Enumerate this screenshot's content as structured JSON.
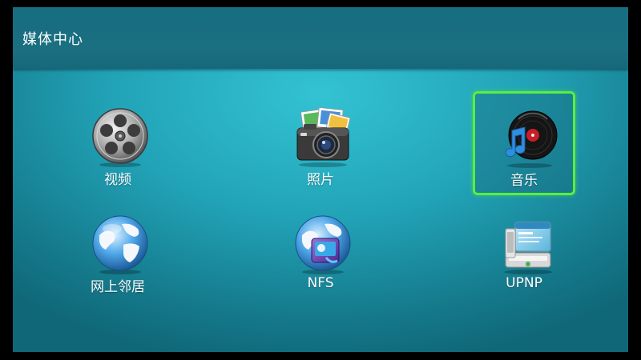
{
  "header": {
    "title": "媒体中心"
  },
  "tiles": [
    {
      "label": "视频",
      "icon": "film-reel-icon"
    },
    {
      "label": "照片",
      "icon": "camera-photos-icon"
    },
    {
      "label": "音乐",
      "icon": "music-vinyl-icon",
      "focused": true
    },
    {
      "label": "网上邻居",
      "icon": "globe-icon"
    },
    {
      "label": "NFS",
      "icon": "globe-network-icon"
    },
    {
      "label": "UPNP",
      "icon": "upnp-device-icon"
    }
  ],
  "colors": {
    "focus_border": "#5aef3c",
    "background": "#22a3b7",
    "header": "#1a6f80"
  }
}
